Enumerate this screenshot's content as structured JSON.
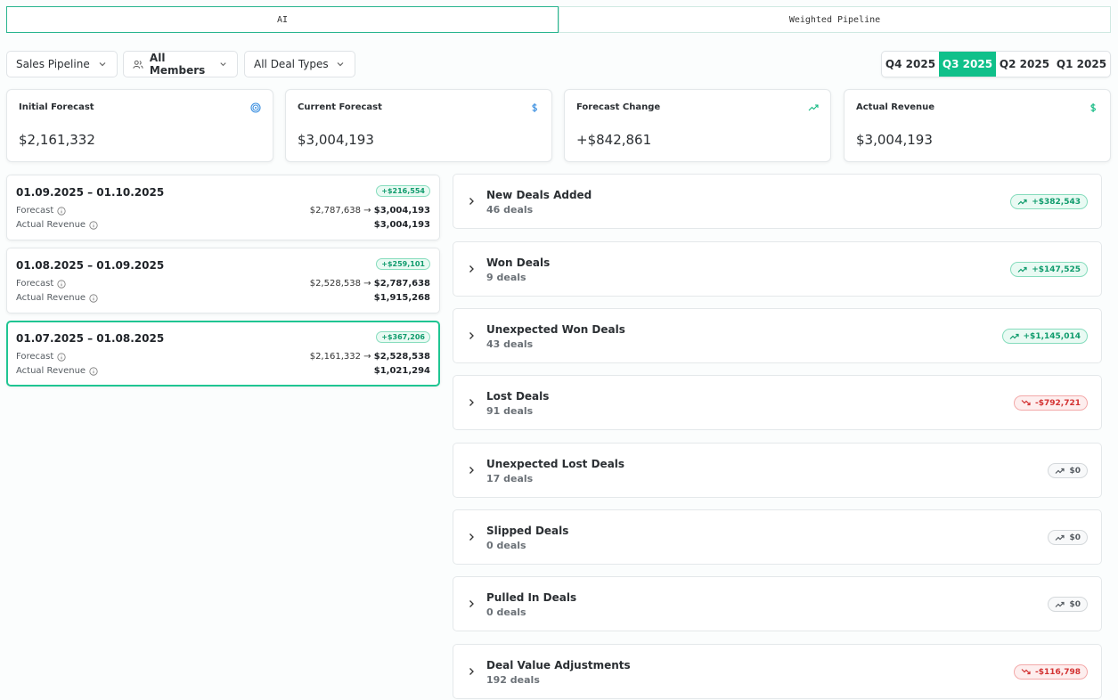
{
  "tabs": [
    {
      "label": "AI",
      "active": true
    },
    {
      "label": "Weighted Pipeline",
      "active": false
    }
  ],
  "filters": {
    "pipeline": "Sales Pipeline",
    "members": "All Members",
    "deal_types": "All Deal Types"
  },
  "quarters": [
    {
      "label": "Q4 2025",
      "active": false
    },
    {
      "label": "Q3 2025",
      "active": true
    },
    {
      "label": "Q2 2025",
      "active": false
    },
    {
      "label": "Q1 2025",
      "active": false
    }
  ],
  "kpis": [
    {
      "label": "Initial Forecast",
      "value": "$2,161,332",
      "icon": "target-icon",
      "color": "#3b8fe0"
    },
    {
      "label": "Current Forecast",
      "value": "$3,004,193",
      "icon": "dollar-icon",
      "color": "#3b8fe0"
    },
    {
      "label": "Forecast Change",
      "value": "+$842,861",
      "icon": "trend-up-icon",
      "color": "#10b981"
    },
    {
      "label": "Actual Revenue",
      "value": "$3,004,193",
      "icon": "dollar-icon",
      "color": "#10b981"
    }
  ],
  "periods": [
    {
      "date": "01.09.2025 – 01.10.2025",
      "badge": "+$216,554",
      "forecast_label": "Forecast",
      "forecast_from": "$2,787,638",
      "arrow": "→",
      "forecast_to": "$3,004,193",
      "actual_label": "Actual Revenue",
      "actual": "$3,004,193",
      "selected": false
    },
    {
      "date": "01.08.2025 – 01.09.2025",
      "badge": "+$259,101",
      "forecast_label": "Forecast",
      "forecast_from": "$2,528,538",
      "arrow": "→",
      "forecast_to": "$2,787,638",
      "actual_label": "Actual Revenue",
      "actual": "$1,915,268",
      "selected": false
    },
    {
      "date": "01.07.2025 – 01.08.2025",
      "badge": "+$367,206",
      "forecast_label": "Forecast",
      "forecast_from": "$2,161,332",
      "arrow": "→",
      "forecast_to": "$2,528,538",
      "actual_label": "Actual Revenue",
      "actual": "$1,021,294",
      "selected": true
    }
  ],
  "categories": [
    {
      "name": "New Deals Added",
      "count": "46 deals",
      "amount": "+$382,543",
      "trend": "pos"
    },
    {
      "name": "Won Deals",
      "count": "9 deals",
      "amount": "+$147,525",
      "trend": "pos"
    },
    {
      "name": "Unexpected Won Deals",
      "count": "43 deals",
      "amount": "+$1,145,014",
      "trend": "pos"
    },
    {
      "name": "Lost Deals",
      "count": "91 deals",
      "amount": "-$792,721",
      "trend": "neg"
    },
    {
      "name": "Unexpected Lost Deals",
      "count": "17 deals",
      "amount": "$0",
      "trend": "zero"
    },
    {
      "name": "Slipped Deals",
      "count": "0 deals",
      "amount": "$0",
      "trend": "zero"
    },
    {
      "name": "Pulled In Deals",
      "count": "0 deals",
      "amount": "$0",
      "trend": "zero"
    },
    {
      "name": "Deal Value Adjustments",
      "count": "192 deals",
      "amount": "-$116,798",
      "trend": "neg"
    }
  ]
}
